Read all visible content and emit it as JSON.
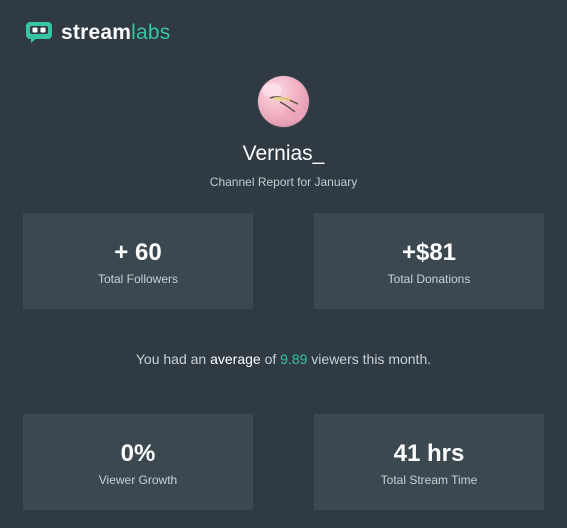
{
  "header": {
    "logo_icon": "streamlabs-robot-icon",
    "logo_strong": "stream",
    "logo_light": "labs",
    "brand_color": "#36c5a0"
  },
  "profile": {
    "avatar_icon": "user-avatar-image",
    "username": "Vernias_",
    "subtitle": "Channel Report for January"
  },
  "stats_top": {
    "followers": {
      "value": "+ 60",
      "label": "Total Followers"
    },
    "donations": {
      "value": "+$81",
      "label": "Total Donations"
    }
  },
  "average": {
    "prefix": "You had an ",
    "emphasis": "average",
    "middle": " of ",
    "value": "9.89",
    "suffix": " viewers this month."
  },
  "stats_bottom": {
    "growth": {
      "value": "0%",
      "label": "Viewer Growth"
    },
    "stream_time": {
      "value": "41 hrs",
      "label": "Total Stream Time"
    }
  },
  "colors": {
    "background": "#2f3a42",
    "card": "#3b4850",
    "accent": "#36c5a0"
  }
}
